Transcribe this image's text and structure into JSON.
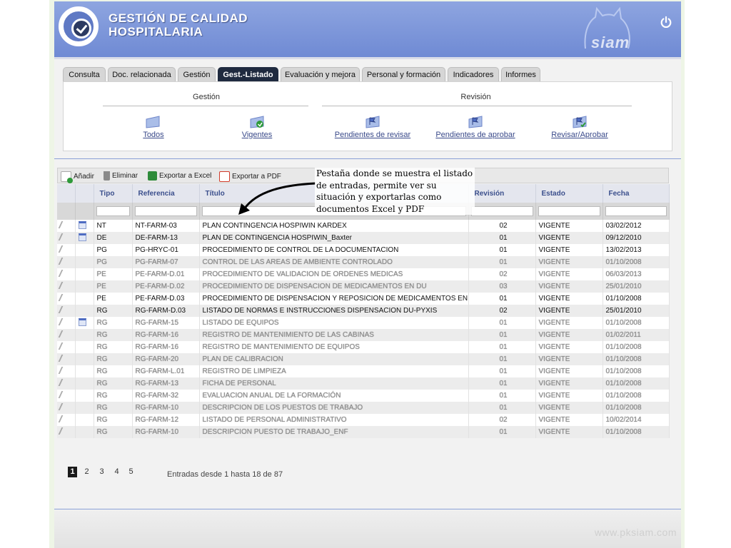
{
  "header": {
    "title_line1": "GESTIÓN DE CALIDAD",
    "title_line2": "HOSPITALARIA",
    "brand": "siam"
  },
  "tabs": [
    {
      "label": "Consulta",
      "active": false
    },
    {
      "label": "Doc. relacionada",
      "active": false
    },
    {
      "label": "Gestión",
      "active": false
    },
    {
      "label": "Gest.-Listado",
      "active": true
    },
    {
      "label": "Evaluación y mejora",
      "active": false
    },
    {
      "label": "Personal y formación",
      "active": false
    },
    {
      "label": "Indicadores",
      "active": false
    },
    {
      "label": "Informes",
      "active": false
    }
  ],
  "panel": {
    "group_gestion": "Gestión",
    "group_revision": "Revisión",
    "links": {
      "todos": "Todos",
      "vigentes": "Vigentes",
      "pendientes_revisar": "Pendientes de revisar",
      "pendientes_aprobar": "Pendientes de aprobar",
      "revisar_aprobar": "Revisar/Aprobar"
    }
  },
  "toolbar": {
    "add": "Añadir",
    "delete": "Eliminar",
    "export_excel": "Exportar a Excel",
    "export_pdf": "Exportar a PDF"
  },
  "table": {
    "headers": {
      "tipo": "Tipo",
      "referencia": "Referencia",
      "titulo": "Título",
      "revision": "Revisión",
      "estado": "Estado",
      "fecha": "Fecha"
    },
    "rows": [
      {
        "doc": true,
        "tipo": "NT",
        "ref": "NT-FARM-03",
        "titulo": "PLAN CONTINGENCIA HOSPIWIN KARDEX",
        "rev": "02",
        "estado": "VIGENTE",
        "fecha": "03/02/2012",
        "blur": false
      },
      {
        "doc": true,
        "tipo": "DE",
        "ref": "DE-FARM-13",
        "titulo": "PLAN DE CONTINGENCIA HOSPIWIN_Baxter",
        "rev": "01",
        "estado": "VIGENTE",
        "fecha": "09/12/2010",
        "blur": false
      },
      {
        "doc": false,
        "tipo": "PG",
        "ref": "PG-HRYC-01",
        "titulo": "PROCEDIMIENTO DE CONTROL DE LA DOCUMENTACION",
        "rev": "01",
        "estado": "VIGENTE",
        "fecha": "13/02/2013",
        "blur": false
      },
      {
        "doc": false,
        "tipo": "PG",
        "ref": "PG-FARM-07",
        "titulo": "CONTROL DE LAS AREAS DE AMBIENTE CONTROLADO",
        "rev": "01",
        "estado": "VIGENTE",
        "fecha": "01/10/2008",
        "blur": true
      },
      {
        "doc": false,
        "tipo": "PE",
        "ref": "PE-FARM-D.01",
        "titulo": "PROCEDIMIENTO DE VALIDACION DE ORDENES MEDICAS",
        "rev": "02",
        "estado": "VIGENTE",
        "fecha": "06/03/2013",
        "blur": true
      },
      {
        "doc": false,
        "tipo": "PE",
        "ref": "PE-FARM-D.02",
        "titulo": "PROCEDIMIENTO DE DISPENSACION DE MEDICAMENTOS EN DU",
        "rev": "03",
        "estado": "VIGENTE",
        "fecha": "25/01/2010",
        "blur": true
      },
      {
        "doc": false,
        "tipo": "PE",
        "ref": "PE-FARM-D.03",
        "titulo": "PROCEDIMIENTO DE DISPENSACION Y REPOSICION DE MEDICAMENTOS EN PYXIS",
        "rev": "01",
        "estado": "VIGENTE",
        "fecha": "01/10/2008",
        "blur": false
      },
      {
        "doc": false,
        "tipo": "RG",
        "ref": "RG-FARM-D.03",
        "titulo": "LISTADO DE NORMAS E INSTRUCCIONES DISPENSACION DU-PYXIS",
        "rev": "02",
        "estado": "VIGENTE",
        "fecha": "25/01/2010",
        "blur": false
      },
      {
        "doc": true,
        "tipo": "RG",
        "ref": "RG-FARM-15",
        "titulo": "LISTADO DE EQUIPOS",
        "rev": "01",
        "estado": "VIGENTE",
        "fecha": "01/10/2008",
        "blur": true
      },
      {
        "doc": false,
        "tipo": "RG",
        "ref": "RG-FARM-16",
        "titulo": "REGISTRO DE MANTENIMIENTO DE LAS CABINAS",
        "rev": "01",
        "estado": "VIGENTE",
        "fecha": "01/02/2011",
        "blur": true
      },
      {
        "doc": false,
        "tipo": "RG",
        "ref": "RG-FARM-16",
        "titulo": "REGISTRO DE MANTENIMIENTO DE EQUIPOS",
        "rev": "01",
        "estado": "VIGENTE",
        "fecha": "01/10/2008",
        "blur": true
      },
      {
        "doc": false,
        "tipo": "RG",
        "ref": "RG-FARM-20",
        "titulo": "PLAN DE CALIBRACION",
        "rev": "01",
        "estado": "VIGENTE",
        "fecha": "01/10/2008",
        "blur": true
      },
      {
        "doc": false,
        "tipo": "RG",
        "ref": "RG-FARM-L.01",
        "titulo": "REGISTRO DE LIMPIEZA",
        "rev": "01",
        "estado": "VIGENTE",
        "fecha": "01/10/2008",
        "blur": true
      },
      {
        "doc": false,
        "tipo": "RG",
        "ref": "RG-FARM-13",
        "titulo": "FICHA DE PERSONAL",
        "rev": "01",
        "estado": "VIGENTE",
        "fecha": "01/10/2008",
        "blur": true
      },
      {
        "doc": false,
        "tipo": "RG",
        "ref": "RG-FARM-32",
        "titulo": "EVALUACION ANUAL DE LA FORMACIÓN",
        "rev": "01",
        "estado": "VIGENTE",
        "fecha": "01/10/2008",
        "blur": true
      },
      {
        "doc": false,
        "tipo": "RG",
        "ref": "RG-FARM-10",
        "titulo": "DESCRIPCION DE LOS PUESTOS DE TRABAJO",
        "rev": "01",
        "estado": "VIGENTE",
        "fecha": "01/10/2008",
        "blur": true
      },
      {
        "doc": false,
        "tipo": "RG",
        "ref": "RG-FARM-12",
        "titulo": "LISTADO DE PERSONAL ADMINISTRATIVO",
        "rev": "02",
        "estado": "VIGENTE",
        "fecha": "10/02/2014",
        "blur": true
      },
      {
        "doc": false,
        "tipo": "RG",
        "ref": "RG-FARM-10",
        "titulo": "DESCRIPCION PUESTO DE TRABAJO_ENF",
        "rev": "01",
        "estado": "VIGENTE",
        "fecha": "01/10/2008",
        "blur": true
      }
    ]
  },
  "pager": {
    "pages": [
      "1",
      "2",
      "3",
      "4",
      "5"
    ],
    "active_page": "1",
    "entries_text": "Entradas desde 1 hasta 18 de 87"
  },
  "footer": {
    "url": "www.pksiam.com"
  },
  "annotation": {
    "text": "Pestaña donde se muestra el listado de entradas, permite ver su situación y exportarlas como documentos Excel y PDF"
  },
  "colors": {
    "header_blue": "#7f97da",
    "active_tab": "#1f2a3f",
    "link": "#3a4a8a",
    "excel_green": "#2e8b3a",
    "pdf_red": "#d03a2a"
  }
}
